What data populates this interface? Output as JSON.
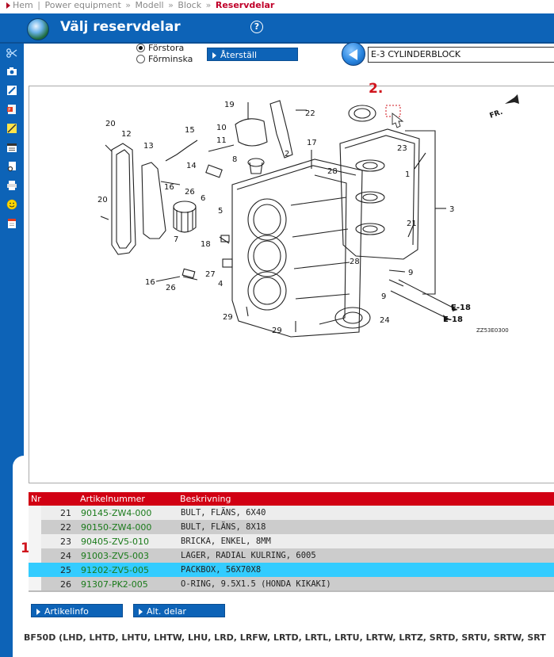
{
  "breadcrumb": {
    "items": [
      "Hem",
      "Power equipment",
      "Modell",
      "Block"
    ],
    "current": "Reservdelar",
    "separators": [
      "|",
      "»",
      "»",
      "»"
    ]
  },
  "header": {
    "title": "Välj reservdelar",
    "help": "?"
  },
  "sidebar": {
    "tools": [
      "scissors-icon",
      "camera-icon",
      "resize-icon",
      "pdf-icon",
      "highlighter-icon",
      "calendar-icon",
      "print-preview-icon",
      "printer-icon",
      "smiley-icon",
      "document-icon"
    ]
  },
  "controls": {
    "zoom_options": [
      "Förstora",
      "Förminska"
    ],
    "zoom_selected": "Förstora",
    "reset_label": "Återställ",
    "block_value": "E-3 CYLINDERBLOCK"
  },
  "diagram": {
    "step_two": "2.",
    "code": "ZZ53E0300",
    "direction": "FR.",
    "callouts": [
      "1",
      "2",
      "3",
      "4",
      "5",
      "6",
      "7",
      "8",
      "9",
      "9",
      "10",
      "11",
      "12",
      "13",
      "14",
      "15",
      "16",
      "16",
      "17",
      "18",
      "19",
      "20",
      "20",
      "21",
      "22",
      "23",
      "24",
      "26",
      "26",
      "27",
      "28",
      "28",
      "29",
      "29",
      "E-18",
      "E-18"
    ]
  },
  "table": {
    "step_one": "1.",
    "headers": {
      "nr": "Nr",
      "article": "Artikelnummer",
      "description": "Beskrivning"
    },
    "rows": [
      {
        "nr": "21",
        "article": "90145-ZW4-000",
        "description": "BULT, FLÄNS, 6X40"
      },
      {
        "nr": "22",
        "article": "90150-ZW4-000",
        "description": "BULT, FLÄNS, 8X18"
      },
      {
        "nr": "23",
        "article": "90405-ZV5-010",
        "description": "BRICKA, ENKEL, 8MM"
      },
      {
        "nr": "24",
        "article": "91003-ZV5-003",
        "description": "LAGER, RADIAL KULRING, 6005"
      },
      {
        "nr": "25",
        "article": "91202-ZV5-005",
        "description": "PACKBOX, 56X70X8"
      },
      {
        "nr": "26",
        "article": "91307-PK2-005",
        "description": "O-RING, 9.5X1.5 (HONDA KIKAKI)"
      }
    ],
    "selected_nr": "25"
  },
  "actions": {
    "article_info": "Artikelinfo",
    "alt_parts": "Alt. delar"
  },
  "footer": {
    "model": "BF50D  (LHD, LHTD, LHTU, LHTW, LHU, LRD, LRFW, LRTD, LRTL, LRTU, LRTW, LRTZ, SRTD, SRTU, SRTW, SRT"
  },
  "colors": {
    "brand_blue": "#0d63b7",
    "header_red": "#d10013",
    "selected_row": "#33ccff",
    "article_green": "#1a7a1a",
    "step_red": "#d0151d"
  }
}
